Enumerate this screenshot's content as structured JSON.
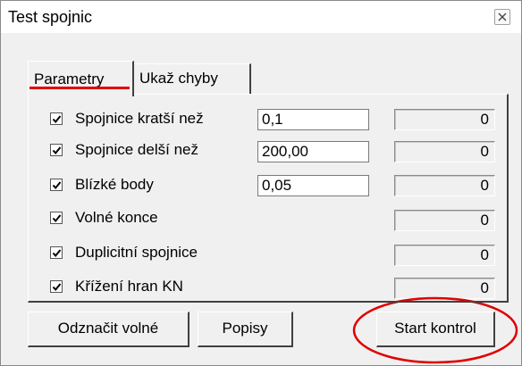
{
  "window": {
    "title": "Test spojnic"
  },
  "tabs": [
    {
      "label": "Parametry"
    },
    {
      "label": "Ukaž chyby"
    }
  ],
  "rows": [
    {
      "checked": true,
      "label": "Spojnice  kratší než",
      "value": "0,1",
      "count": "0"
    },
    {
      "checked": true,
      "label": "Spojnice delší než",
      "value": "200,00",
      "count": "0"
    },
    {
      "checked": true,
      "label": "Blízké body",
      "value": "0,05",
      "count": "0"
    },
    {
      "checked": true,
      "label": "Volné konce",
      "count": "0"
    },
    {
      "checked": true,
      "label": "Duplicitní spojnice",
      "count": "0"
    },
    {
      "checked": true,
      "label": "Křížení hran KN",
      "count": "0"
    }
  ],
  "buttons": {
    "unmark_free": "Odznačit volné",
    "labels": "Popisy",
    "start": "Start kontrol"
  },
  "annotation_color": "#e00000"
}
